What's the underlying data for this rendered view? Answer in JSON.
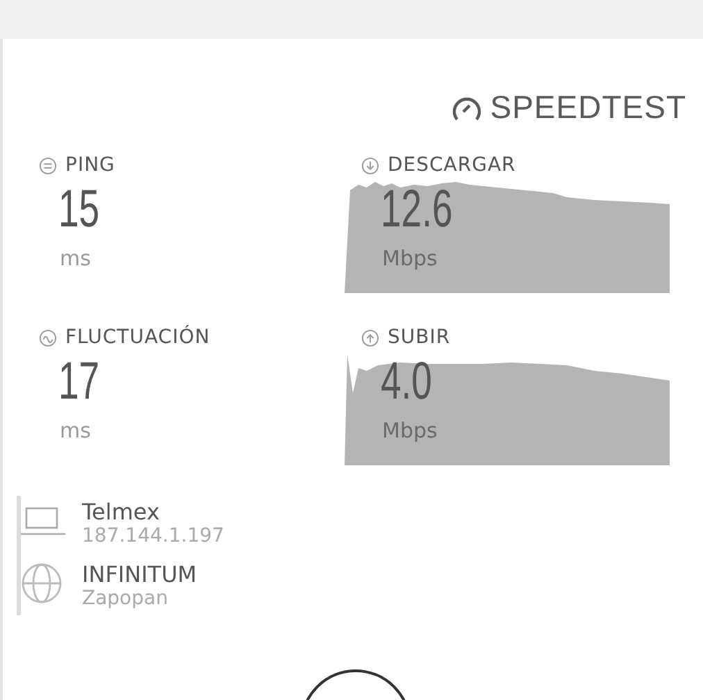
{
  "logo": {
    "text": "SPEEDTEST"
  },
  "metrics": [
    {
      "kind": "ping",
      "label": "PING",
      "value": "15",
      "unit": "ms"
    },
    {
      "kind": "download",
      "label": "DESCARGAR",
      "value": "12.6",
      "unit": "Mbps"
    },
    {
      "kind": "jitter",
      "label": "FLUCTUACIÓN",
      "value": "17",
      "unit": "ms"
    },
    {
      "kind": "upload",
      "label": "SUBIR",
      "value": "4.0",
      "unit": "Mbps"
    }
  ],
  "connections": [
    {
      "kind": "client",
      "name": "Telmex",
      "detail": "187.144.1.197"
    },
    {
      "kind": "server",
      "name": "INFINITUM",
      "detail": "Zapopan"
    }
  ]
}
